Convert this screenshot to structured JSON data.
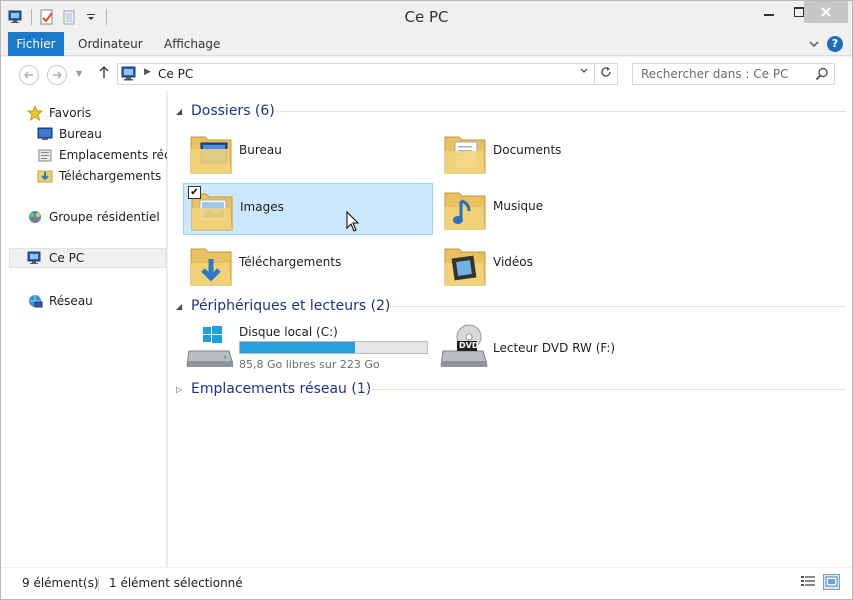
{
  "window": {
    "title": "Ce PC"
  },
  "ribbon": {
    "tabs": [
      {
        "label": "Fichier"
      },
      {
        "label": "Ordinateur"
      },
      {
        "label": "Affichage"
      }
    ],
    "help_label": "?"
  },
  "address": {
    "crumb": "Ce PC",
    "search_placeholder": "Rechercher dans : Ce PC"
  },
  "nav": {
    "items": [
      {
        "label": "Favoris",
        "icon": "star-icon"
      },
      {
        "label": "Bureau",
        "icon": "desktop-icon"
      },
      {
        "label": "Emplacements récents",
        "icon": "recent-places-icon"
      },
      {
        "label": "Téléchargements",
        "icon": "downloads-folder-icon"
      },
      {
        "label": "Groupe résidentiel",
        "icon": "homegroup-icon"
      },
      {
        "label": "Ce PC",
        "icon": "computer-icon"
      },
      {
        "label": "Réseau",
        "icon": "network-icon"
      }
    ]
  },
  "groups": {
    "folders_title": "Dossiers (6)",
    "devices_title": "Périphériques et lecteurs (2)",
    "network_title": "Emplacements réseau (1)"
  },
  "folders": [
    {
      "label": "Bureau",
      "icon": "desktop-folder-icon"
    },
    {
      "label": "Documents",
      "icon": "documents-folder-icon"
    },
    {
      "label": "Images",
      "icon": "pictures-folder-icon",
      "selected": true
    },
    {
      "label": "Musique",
      "icon": "music-folder-icon"
    },
    {
      "label": "Téléchargements",
      "icon": "downloads-folder-icon"
    },
    {
      "label": "Vidéos",
      "icon": "videos-folder-icon"
    }
  ],
  "drives": [
    {
      "label": "Disque local (C:)",
      "free_text": "85,8 Go libres sur 223 Go",
      "used_fraction": 0.615,
      "icon": "windows-drive-icon"
    },
    {
      "label": "Lecteur DVD RW (F:)",
      "icon": "dvd-drive-icon",
      "badge": "DVD"
    }
  ],
  "status": {
    "count": "9 élément(s)",
    "selection": "1 élément sélectionné"
  },
  "colors": {
    "accent": "#1979ca",
    "group_heading": "#1e3287",
    "selection_bg": "#cce8ff",
    "progress_fill": "#26a0da"
  }
}
